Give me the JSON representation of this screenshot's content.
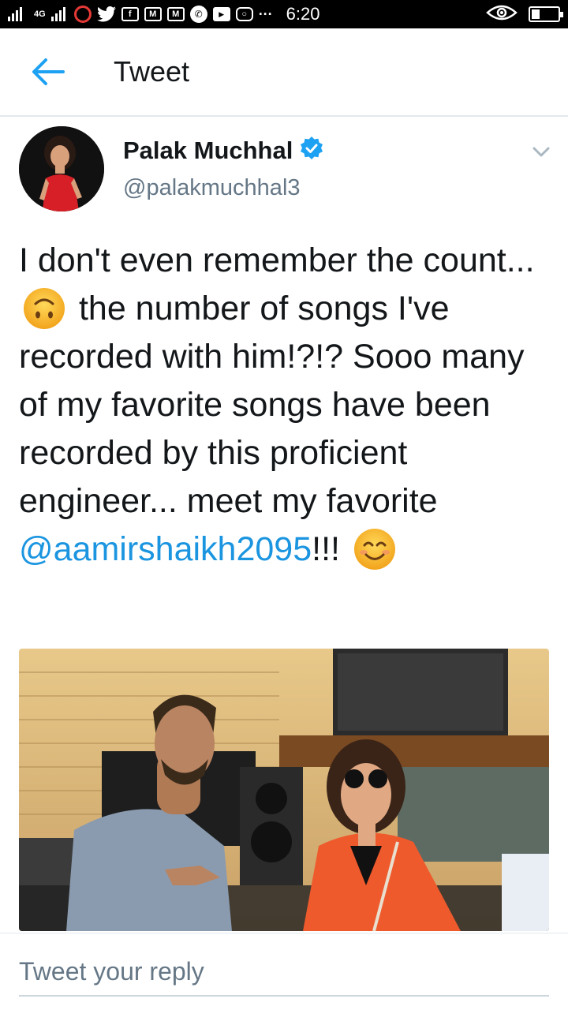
{
  "status_bar": {
    "time": "6:20",
    "network_label": "4G",
    "app_icons": [
      "sim-icon",
      "signal-icon",
      "vodafone-icon",
      "twitter-icon",
      "facebook-icon",
      "gmail-icon",
      "gmail-icon",
      "phone-icon",
      "youtube-icon",
      "instagram-icon",
      "more-dots-icon"
    ],
    "more": "···",
    "battery_level": 0.3
  },
  "appbar": {
    "title": "Tweet"
  },
  "tweet": {
    "author_name": "Palak Muchhal",
    "author_handle": "@palakmuchhal3",
    "verified": true,
    "text_parts": {
      "p1": "I don't even remember the count...",
      "p2": "the number of songs I've recorded with him!?!? Sooo many of my favorite songs have been recorded by this proficient engineer... meet my favorite",
      "mention": "@aamirshaikh2095",
      "p3": "!!!"
    },
    "emojis": [
      "upside-down-face-emoji",
      "smiling-face-emoji"
    ]
  },
  "reply": {
    "placeholder": "Tweet your reply"
  },
  "colors": {
    "accent": "#1da1f2",
    "mention": "#1b95e0",
    "secondary_text": "#657786",
    "divider": "#e1e8ed"
  }
}
